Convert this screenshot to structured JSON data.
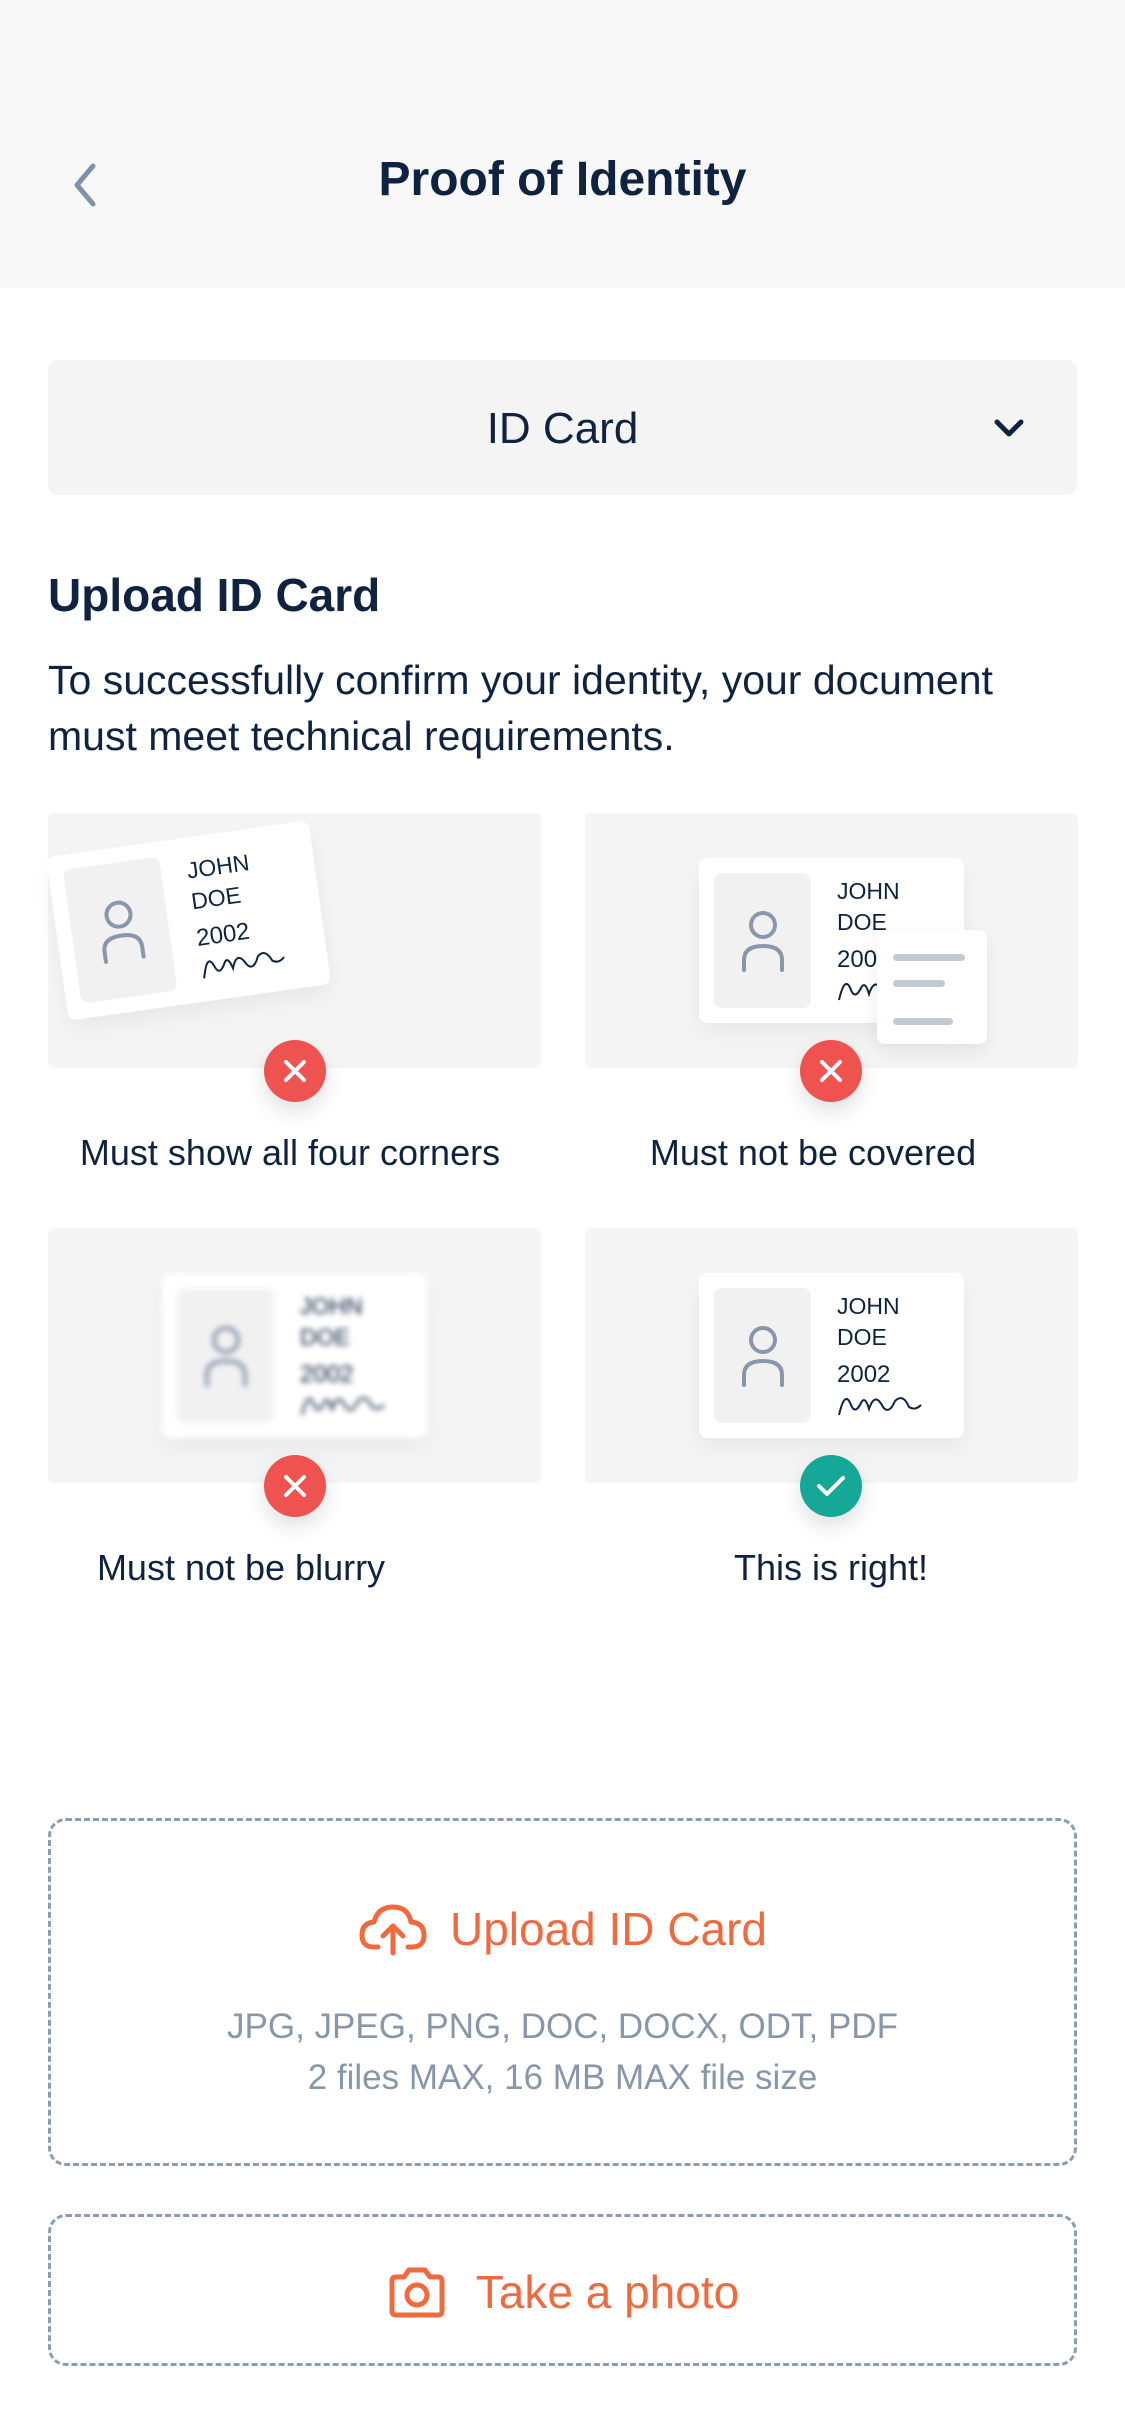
{
  "header": {
    "title": "Proof of Identity"
  },
  "document_select": {
    "value": "ID Card"
  },
  "section": {
    "title": "Upload ID Card",
    "description": "To successfully confirm your identity, your document must meet technical requirements."
  },
  "sample_card": {
    "name": "JOHN\nDOE",
    "year": "2002"
  },
  "requirements": [
    {
      "caption": "Must show all four corners",
      "status": "bad"
    },
    {
      "caption": "Must not be covered",
      "status": "bad"
    },
    {
      "caption": "Must not be blurry",
      "status": "bad"
    },
    {
      "caption": "This is right!",
      "status": "good"
    }
  ],
  "upload": {
    "label": "Upload ID Card",
    "formats": "JPG, JPEG, PNG, DOC, DOCX, ODT, PDF",
    "limits": "2 files MAX, 16 MB MAX file size"
  },
  "photo": {
    "label": "Take a photo"
  },
  "colors": {
    "accent": "#ee6a3f",
    "error": "#ef5350",
    "success": "#15a897",
    "text": "#0f2341",
    "muted": "#8896aa"
  },
  "icons": [
    "chevron-left-icon",
    "chevron-down-icon",
    "person-icon",
    "close-icon",
    "check-icon",
    "cloud-upload-icon",
    "camera-icon"
  ]
}
